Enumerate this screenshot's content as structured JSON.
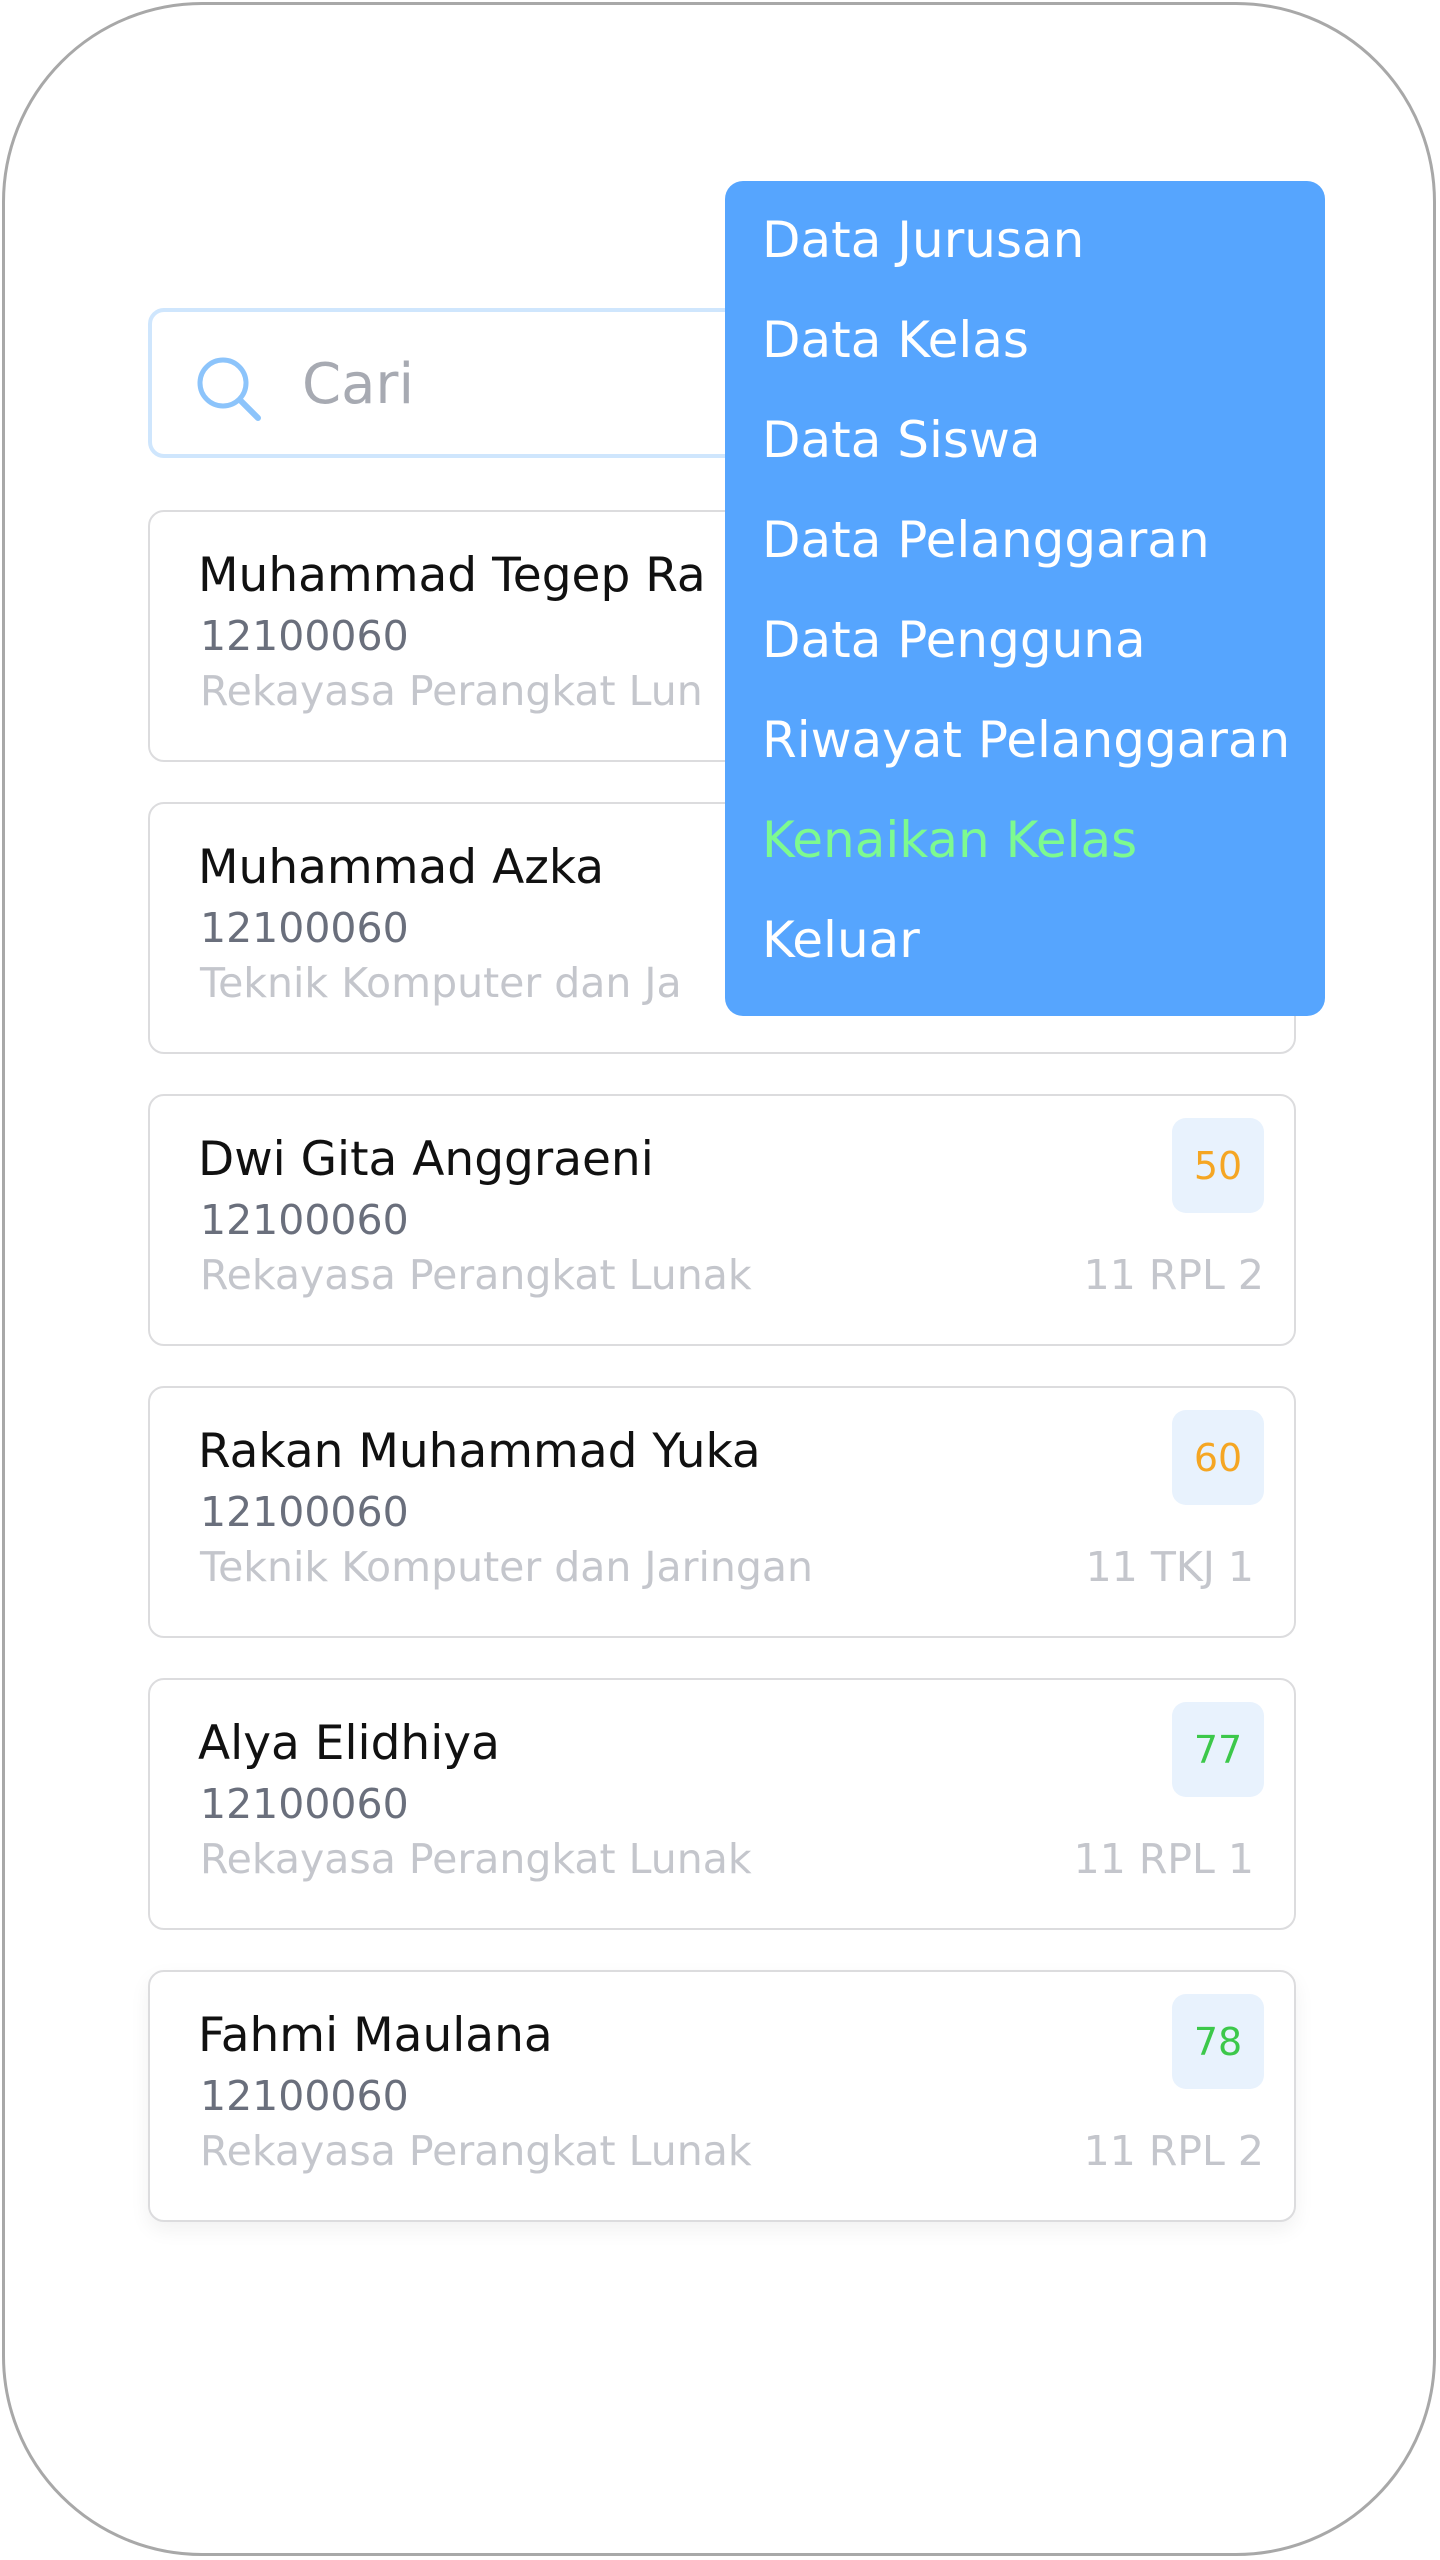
{
  "search": {
    "placeholder": "Cari",
    "icon": "search-icon"
  },
  "students": [
    {
      "name": "Muhammad Tegep Ra",
      "nis": "12100060",
      "major": "Rekayasa Perangkat Lun",
      "class": "",
      "score": ""
    },
    {
      "name": "Muhammad Azka",
      "nis": "12100060",
      "major": "Teknik Komputer dan Ja",
      "class": "",
      "score": ""
    },
    {
      "name": "Dwi Gita Anggraeni",
      "nis": "12100060",
      "major": "Rekayasa Perangkat Lunak",
      "class": "11 RPL 2",
      "score": "50"
    },
    {
      "name": "Rakan Muhammad Yuka",
      "nis": "12100060",
      "major": "Teknik Komputer dan Jaringan",
      "class": "11 TKJ 1",
      "score": "60"
    },
    {
      "name": "Alya Elidhiya",
      "nis": "12100060",
      "major": "Rekayasa Perangkat Lunak",
      "class": "11 RPL 1",
      "score": "77"
    },
    {
      "name": "Fahmi Maulana",
      "nis": "12100060",
      "major": "Rekayasa Perangkat Lunak",
      "class": "11 RPL 2",
      "score": "78"
    }
  ],
  "menu": {
    "items": [
      "Data Jurusan",
      "Data Kelas",
      "Data Siswa",
      "Data Pelanggaran",
      "Data Pengguna",
      "Riwayat Pelanggaran",
      "Kenaikan Kelas",
      "Keluar"
    ],
    "active_index": 6
  },
  "colors": {
    "menu_background": "#56a5fe",
    "menu_active_text": "#7dfa90",
    "score_mid": "#f5a623",
    "score_good": "#3cc84a",
    "score_badge_bg": "#e8f2fd"
  }
}
